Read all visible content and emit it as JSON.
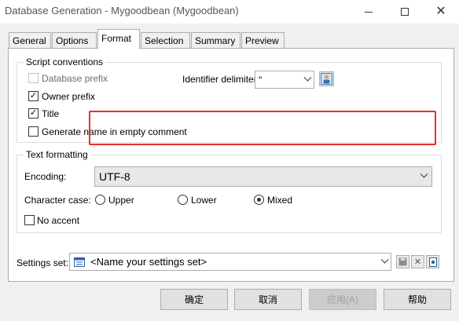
{
  "window": {
    "title": "Database Generation - Mygoodbean (Mygoodbean)"
  },
  "tabs": [
    {
      "label": "General"
    },
    {
      "label": "Options"
    },
    {
      "label": "Format",
      "active": true
    },
    {
      "label": "Selection"
    },
    {
      "label": "Summary"
    },
    {
      "label": "Preview"
    }
  ],
  "script_conventions": {
    "title": "Script conventions",
    "database_prefix": {
      "label": "Database prefix",
      "checked": false,
      "enabled": false
    },
    "owner_prefix": {
      "label": "Owner prefix",
      "checked": true
    },
    "title_option": {
      "label": "Title",
      "checked": true
    },
    "generate_name": {
      "label": "Generate name in empty comment",
      "checked": false
    },
    "identifier_delimiter": {
      "label": "Identifier delimiter:",
      "value": "\""
    }
  },
  "text_formatting": {
    "title": "Text formatting",
    "encoding": {
      "label": "Encoding:",
      "value": "UTF-8"
    },
    "character_case": {
      "label": "Character case:",
      "options": [
        "Upper",
        "Lower",
        "Mixed"
      ],
      "selected": "Mixed"
    },
    "no_accent": {
      "label": "No accent",
      "checked": false
    }
  },
  "settings_set": {
    "label": "Settings set:",
    "value": "<Name your settings set>"
  },
  "buttons": {
    "ok": "确定",
    "cancel": "取消",
    "apply": "应用(A)",
    "help": "帮助"
  },
  "colors": {
    "highlight": "#e5302a",
    "panel": "#ffffff",
    "window_bg": "#f0f0f0"
  }
}
